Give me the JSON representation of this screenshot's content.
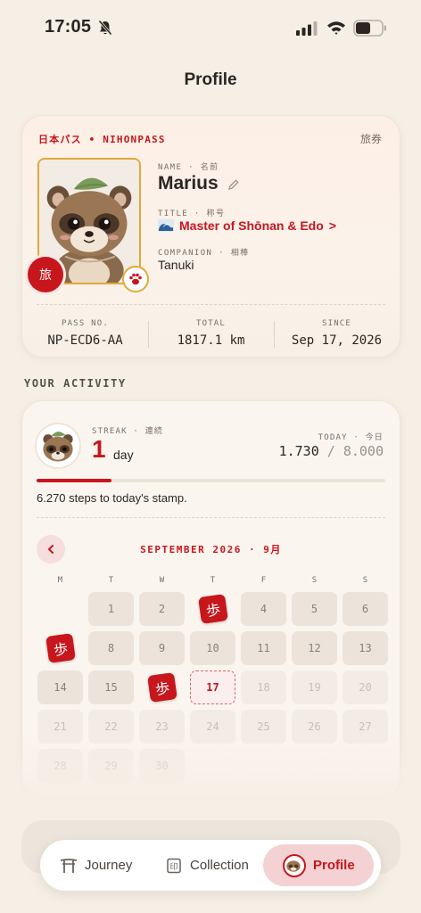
{
  "status": {
    "time": "17:05"
  },
  "header": {
    "title": "Profile"
  },
  "pass": {
    "brand": "日本パス • NIHONPASS",
    "kanji": "旅券",
    "seal_char": "旅",
    "name_label": "NAME · 名前",
    "name": "Marius",
    "title_label": "TITLE · 称号",
    "title": "Master of Shōnan & Edo",
    "title_chevron": ">",
    "companion_label": "COMPANION · 相棒",
    "companion": "Tanuki",
    "stats": [
      {
        "label": "PASS NO.",
        "value": "NP-ECD6-AA"
      },
      {
        "label": "TOTAL",
        "value": "1817.1 km"
      },
      {
        "label": "SINCE",
        "value": "Sep 17, 2026"
      }
    ]
  },
  "activity": {
    "section_label": "YOUR ACTIVITY",
    "streak_label": "STREAK · 連続",
    "streak_number": "1",
    "streak_unit": "day",
    "today_label": "TODAY · 今日",
    "today_steps": "1.730",
    "today_goal": "/ 8.000",
    "progress_fraction": 0.216,
    "steps_message": "6.270 steps to today's stamp.",
    "calendar": {
      "month_title": "SEPTEMBER 2026 · 9月",
      "weekdays": [
        "M",
        "T",
        "W",
        "T",
        "F",
        "S",
        "S"
      ],
      "stamp_char": "歩",
      "days": [
        {
          "label": "",
          "state": "empty"
        },
        {
          "label": "1",
          "state": "past"
        },
        {
          "label": "2",
          "state": "past"
        },
        {
          "label": "3",
          "state": "stamped"
        },
        {
          "label": "4",
          "state": "past"
        },
        {
          "label": "5",
          "state": "past"
        },
        {
          "label": "6",
          "state": "past"
        },
        {
          "label": "7",
          "state": "stamped"
        },
        {
          "label": "8",
          "state": "past"
        },
        {
          "label": "9",
          "state": "past"
        },
        {
          "label": "10",
          "state": "past"
        },
        {
          "label": "11",
          "state": "past"
        },
        {
          "label": "12",
          "state": "past"
        },
        {
          "label": "13",
          "state": "past"
        },
        {
          "label": "14",
          "state": "past"
        },
        {
          "label": "15",
          "state": "past"
        },
        {
          "label": "16",
          "state": "stamped"
        },
        {
          "label": "17",
          "state": "today"
        },
        {
          "label": "18",
          "state": "future"
        },
        {
          "label": "19",
          "state": "future"
        },
        {
          "label": "20",
          "state": "future"
        },
        {
          "label": "21",
          "state": "future"
        },
        {
          "label": "22",
          "state": "future"
        },
        {
          "label": "23",
          "state": "future"
        },
        {
          "label": "24",
          "state": "future"
        },
        {
          "label": "25",
          "state": "future"
        },
        {
          "label": "26",
          "state": "future"
        },
        {
          "label": "27",
          "state": "future"
        },
        {
          "label": "28",
          "state": "future"
        },
        {
          "label": "29",
          "state": "future"
        },
        {
          "label": "30",
          "state": "future"
        }
      ]
    }
  },
  "tabs": [
    {
      "label": "Journey",
      "icon": "torii-icon"
    },
    {
      "label": "Collection",
      "icon": "stamp-book-icon"
    },
    {
      "label": "Profile",
      "icon": "avatar-icon",
      "active": true
    }
  ],
  "colors": {
    "accent": "#c8161d",
    "background": "#f5efe6",
    "gold": "#e0a93c"
  }
}
